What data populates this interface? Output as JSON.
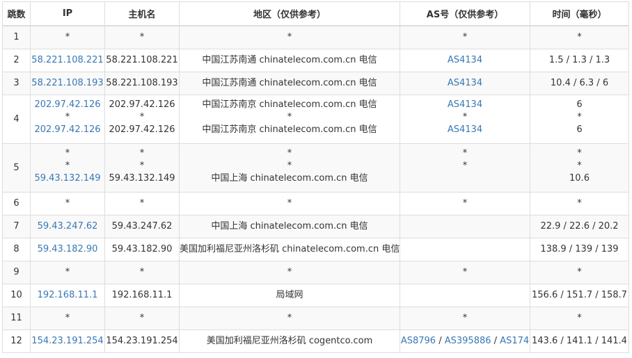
{
  "headers": {
    "hop": "跳数",
    "ip": "IP",
    "host": "主机名",
    "region": "地区（仅供参考）",
    "asn": "AS号（仅供参考）",
    "time": "时间（毫秒）"
  },
  "colors": {
    "link": "#3877b5",
    "text": "#333333",
    "border": "#dddddd",
    "stripe": "#f9f9f9"
  },
  "rows": [
    {
      "hop": "1",
      "lines": [
        {
          "ip": "*",
          "host": "*",
          "region": "*",
          "asn": [
            "*"
          ],
          "time": "*"
        }
      ]
    },
    {
      "hop": "2",
      "lines": [
        {
          "ip": "58.221.108.221",
          "host": "58.221.108.221",
          "region": "中国江苏南通 chinatelecom.com.cn 电信",
          "asn": [
            "AS4134"
          ],
          "time": "1.5 / 1.3 / 1.3"
        }
      ]
    },
    {
      "hop": "3",
      "lines": [
        {
          "ip": "58.221.108.193",
          "host": "58.221.108.193",
          "region": "中国江苏南通 chinatelecom.com.cn 电信",
          "asn": [
            "AS4134"
          ],
          "time": "10.4 / 6.3 / 6"
        }
      ]
    },
    {
      "hop": "4",
      "lines": [
        {
          "ip": "202.97.42.126",
          "host": "202.97.42.126",
          "region": "中国江苏南京 chinatelecom.com.cn 电信",
          "asn": [
            "AS4134"
          ],
          "time": "6"
        },
        {
          "ip": "*",
          "host": "*",
          "region": "*",
          "asn": [
            "*"
          ],
          "time": "*"
        },
        {
          "ip": "202.97.42.126",
          "host": "202.97.42.126",
          "region": "中国江苏南京 chinatelecom.com.cn 电信",
          "asn": [
            "AS4134"
          ],
          "time": "6"
        }
      ]
    },
    {
      "hop": "5",
      "lines": [
        {
          "ip": "*",
          "host": "*",
          "region": "*",
          "asn": [
            "*"
          ],
          "time": "*"
        },
        {
          "ip": "*",
          "host": "*",
          "region": "*",
          "asn": [
            "*"
          ],
          "time": "*"
        },
        {
          "ip": "59.43.132.149",
          "host": "59.43.132.149",
          "region": "中国上海 chinatelecom.com.cn 电信",
          "asn": [],
          "time": "10.6"
        }
      ]
    },
    {
      "hop": "6",
      "lines": [
        {
          "ip": "*",
          "host": "*",
          "region": "*",
          "asn": [
            "*"
          ],
          "time": "*"
        }
      ]
    },
    {
      "hop": "7",
      "lines": [
        {
          "ip": "59.43.247.62",
          "host": "59.43.247.62",
          "region": "中国上海 chinatelecom.com.cn 电信",
          "asn": [],
          "time": "22.9 / 22.6 / 20.2"
        }
      ]
    },
    {
      "hop": "8",
      "lines": [
        {
          "ip": "59.43.182.90",
          "host": "59.43.182.90",
          "region": "美国加利福尼亚州洛杉矶 chinatelecom.com.cn 电信",
          "asn": [],
          "time": "138.9 / 139 / 139"
        }
      ]
    },
    {
      "hop": "9",
      "lines": [
        {
          "ip": "*",
          "host": "*",
          "region": "*",
          "asn": [
            "*"
          ],
          "time": "*"
        }
      ]
    },
    {
      "hop": "10",
      "lines": [
        {
          "ip": "192.168.11.1",
          "host": "192.168.11.1",
          "region": "局域网",
          "asn": [],
          "time": "156.6 / 151.7 / 158.7"
        }
      ]
    },
    {
      "hop": "11",
      "lines": [
        {
          "ip": "*",
          "host": "*",
          "region": "*",
          "asn": [
            "*"
          ],
          "time": "*"
        }
      ]
    },
    {
      "hop": "12",
      "lines": [
        {
          "ip": "154.23.191.254",
          "host": "154.23.191.254",
          "region": "美国加利福尼亚州洛杉矶 cogentco.com",
          "asn": [
            "AS8796",
            "AS395886",
            "AS174"
          ],
          "time": "143.6 / 141.1 / 141.4"
        }
      ]
    }
  ]
}
